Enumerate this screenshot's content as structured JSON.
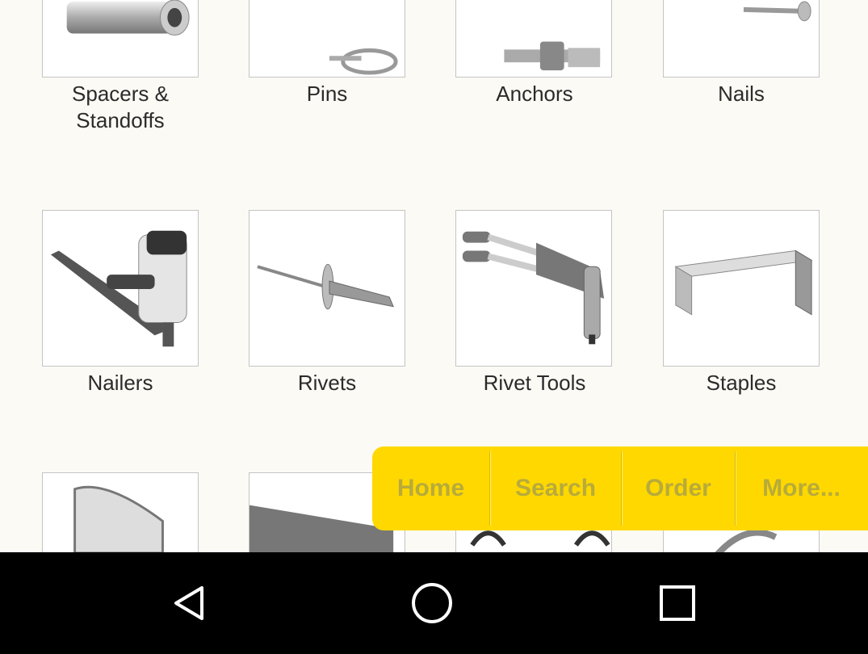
{
  "categories": {
    "row1": [
      {
        "label_line1": "Spacers &",
        "label_line2": "Standoffs",
        "icon": "spacer-icon"
      },
      {
        "label_line1": "Pins",
        "label_line2": "",
        "icon": "pin-icon"
      },
      {
        "label_line1": "Anchors",
        "label_line2": "",
        "icon": "anchor-icon"
      },
      {
        "label_line1": "Nails",
        "label_line2": "",
        "icon": "nail-icon"
      }
    ],
    "row2": [
      {
        "label": "Nailers",
        "icon": "nailer-icon"
      },
      {
        "label": "Rivets",
        "icon": "rivet-icon"
      },
      {
        "label": "Rivet Tools",
        "icon": "rivet-tool-icon"
      },
      {
        "label": "Staples",
        "icon": "staples-icon"
      }
    ],
    "row3_icons": [
      "stapler-icon",
      "bar-stock-icon",
      "clamp-icon",
      "cable-tie-icon"
    ]
  },
  "bottom_nav": {
    "home": "Home",
    "search": "Search",
    "order": "Order",
    "more": "More..."
  },
  "system_nav": {
    "back": "back-icon",
    "home": "home-circle-icon",
    "recents": "recents-icon"
  },
  "colors": {
    "background": "#fbfaf5",
    "nav_bar": "#ffd800",
    "nav_text": "#b8ab3a",
    "system_bar": "#000000"
  }
}
